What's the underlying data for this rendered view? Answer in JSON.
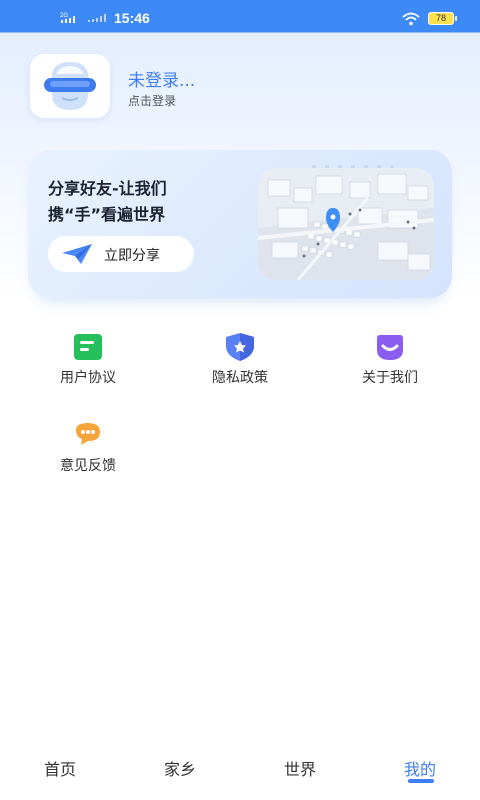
{
  "status_bar": {
    "time": "15:46",
    "network": "2G",
    "battery": "78"
  },
  "profile": {
    "title": "未登录...",
    "subtitle": "点击登录"
  },
  "banner": {
    "title_line1": "分享好友-让我们",
    "title_line2": "携“手”看遍世界",
    "share_button": "立即分享"
  },
  "menu": [
    {
      "label": "用户协议",
      "icon": "document-icon"
    },
    {
      "label": "隐私政策",
      "icon": "shield-icon"
    },
    {
      "label": "关于我们",
      "icon": "smile-icon"
    },
    {
      "label": "意见反馈",
      "icon": "chat-bubble-icon"
    }
  ],
  "tabs": [
    {
      "label": "首页"
    },
    {
      "label": "家乡"
    },
    {
      "label": "世界"
    },
    {
      "label": "我的"
    }
  ],
  "colors": {
    "accent": "#3f7ff0",
    "status_bar": "#3d8af7"
  }
}
